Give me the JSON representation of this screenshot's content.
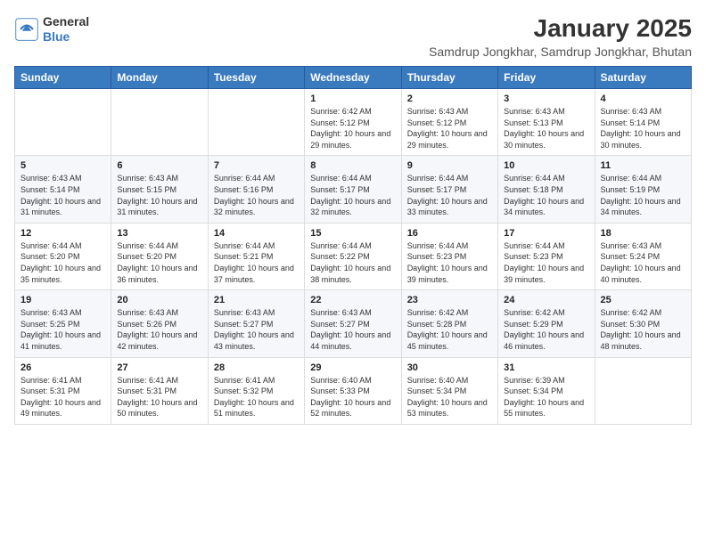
{
  "header": {
    "logo_general": "General",
    "logo_blue": "Blue",
    "title": "January 2025",
    "subtitle": "Samdrup Jongkhar, Samdrup Jongkhar, Bhutan"
  },
  "weekdays": [
    "Sunday",
    "Monday",
    "Tuesday",
    "Wednesday",
    "Thursday",
    "Friday",
    "Saturday"
  ],
  "weeks": [
    [
      {
        "date": "",
        "sunrise": "",
        "sunset": "",
        "daylight": ""
      },
      {
        "date": "",
        "sunrise": "",
        "sunset": "",
        "daylight": ""
      },
      {
        "date": "",
        "sunrise": "",
        "sunset": "",
        "daylight": ""
      },
      {
        "date": "1",
        "sunrise": "Sunrise: 6:42 AM",
        "sunset": "Sunset: 5:12 PM",
        "daylight": "Daylight: 10 hours and 29 minutes."
      },
      {
        "date": "2",
        "sunrise": "Sunrise: 6:43 AM",
        "sunset": "Sunset: 5:12 PM",
        "daylight": "Daylight: 10 hours and 29 minutes."
      },
      {
        "date": "3",
        "sunrise": "Sunrise: 6:43 AM",
        "sunset": "Sunset: 5:13 PM",
        "daylight": "Daylight: 10 hours and 30 minutes."
      },
      {
        "date": "4",
        "sunrise": "Sunrise: 6:43 AM",
        "sunset": "Sunset: 5:14 PM",
        "daylight": "Daylight: 10 hours and 30 minutes."
      }
    ],
    [
      {
        "date": "5",
        "sunrise": "Sunrise: 6:43 AM",
        "sunset": "Sunset: 5:14 PM",
        "daylight": "Daylight: 10 hours and 31 minutes."
      },
      {
        "date": "6",
        "sunrise": "Sunrise: 6:43 AM",
        "sunset": "Sunset: 5:15 PM",
        "daylight": "Daylight: 10 hours and 31 minutes."
      },
      {
        "date": "7",
        "sunrise": "Sunrise: 6:44 AM",
        "sunset": "Sunset: 5:16 PM",
        "daylight": "Daylight: 10 hours and 32 minutes."
      },
      {
        "date": "8",
        "sunrise": "Sunrise: 6:44 AM",
        "sunset": "Sunset: 5:17 PM",
        "daylight": "Daylight: 10 hours and 32 minutes."
      },
      {
        "date": "9",
        "sunrise": "Sunrise: 6:44 AM",
        "sunset": "Sunset: 5:17 PM",
        "daylight": "Daylight: 10 hours and 33 minutes."
      },
      {
        "date": "10",
        "sunrise": "Sunrise: 6:44 AM",
        "sunset": "Sunset: 5:18 PM",
        "daylight": "Daylight: 10 hours and 34 minutes."
      },
      {
        "date": "11",
        "sunrise": "Sunrise: 6:44 AM",
        "sunset": "Sunset: 5:19 PM",
        "daylight": "Daylight: 10 hours and 34 minutes."
      }
    ],
    [
      {
        "date": "12",
        "sunrise": "Sunrise: 6:44 AM",
        "sunset": "Sunset: 5:20 PM",
        "daylight": "Daylight: 10 hours and 35 minutes."
      },
      {
        "date": "13",
        "sunrise": "Sunrise: 6:44 AM",
        "sunset": "Sunset: 5:20 PM",
        "daylight": "Daylight: 10 hours and 36 minutes."
      },
      {
        "date": "14",
        "sunrise": "Sunrise: 6:44 AM",
        "sunset": "Sunset: 5:21 PM",
        "daylight": "Daylight: 10 hours and 37 minutes."
      },
      {
        "date": "15",
        "sunrise": "Sunrise: 6:44 AM",
        "sunset": "Sunset: 5:22 PM",
        "daylight": "Daylight: 10 hours and 38 minutes."
      },
      {
        "date": "16",
        "sunrise": "Sunrise: 6:44 AM",
        "sunset": "Sunset: 5:23 PM",
        "daylight": "Daylight: 10 hours and 39 minutes."
      },
      {
        "date": "17",
        "sunrise": "Sunrise: 6:44 AM",
        "sunset": "Sunset: 5:23 PM",
        "daylight": "Daylight: 10 hours and 39 minutes."
      },
      {
        "date": "18",
        "sunrise": "Sunrise: 6:43 AM",
        "sunset": "Sunset: 5:24 PM",
        "daylight": "Daylight: 10 hours and 40 minutes."
      }
    ],
    [
      {
        "date": "19",
        "sunrise": "Sunrise: 6:43 AM",
        "sunset": "Sunset: 5:25 PM",
        "daylight": "Daylight: 10 hours and 41 minutes."
      },
      {
        "date": "20",
        "sunrise": "Sunrise: 6:43 AM",
        "sunset": "Sunset: 5:26 PM",
        "daylight": "Daylight: 10 hours and 42 minutes."
      },
      {
        "date": "21",
        "sunrise": "Sunrise: 6:43 AM",
        "sunset": "Sunset: 5:27 PM",
        "daylight": "Daylight: 10 hours and 43 minutes."
      },
      {
        "date": "22",
        "sunrise": "Sunrise: 6:43 AM",
        "sunset": "Sunset: 5:27 PM",
        "daylight": "Daylight: 10 hours and 44 minutes."
      },
      {
        "date": "23",
        "sunrise": "Sunrise: 6:42 AM",
        "sunset": "Sunset: 5:28 PM",
        "daylight": "Daylight: 10 hours and 45 minutes."
      },
      {
        "date": "24",
        "sunrise": "Sunrise: 6:42 AM",
        "sunset": "Sunset: 5:29 PM",
        "daylight": "Daylight: 10 hours and 46 minutes."
      },
      {
        "date": "25",
        "sunrise": "Sunrise: 6:42 AM",
        "sunset": "Sunset: 5:30 PM",
        "daylight": "Daylight: 10 hours and 48 minutes."
      }
    ],
    [
      {
        "date": "26",
        "sunrise": "Sunrise: 6:41 AM",
        "sunset": "Sunset: 5:31 PM",
        "daylight": "Daylight: 10 hours and 49 minutes."
      },
      {
        "date": "27",
        "sunrise": "Sunrise: 6:41 AM",
        "sunset": "Sunset: 5:31 PM",
        "daylight": "Daylight: 10 hours and 50 minutes."
      },
      {
        "date": "28",
        "sunrise": "Sunrise: 6:41 AM",
        "sunset": "Sunset: 5:32 PM",
        "daylight": "Daylight: 10 hours and 51 minutes."
      },
      {
        "date": "29",
        "sunrise": "Sunrise: 6:40 AM",
        "sunset": "Sunset: 5:33 PM",
        "daylight": "Daylight: 10 hours and 52 minutes."
      },
      {
        "date": "30",
        "sunrise": "Sunrise: 6:40 AM",
        "sunset": "Sunset: 5:34 PM",
        "daylight": "Daylight: 10 hours and 53 minutes."
      },
      {
        "date": "31",
        "sunrise": "Sunrise: 6:39 AM",
        "sunset": "Sunset: 5:34 PM",
        "daylight": "Daylight: 10 hours and 55 minutes."
      },
      {
        "date": "",
        "sunrise": "",
        "sunset": "",
        "daylight": ""
      }
    ]
  ]
}
